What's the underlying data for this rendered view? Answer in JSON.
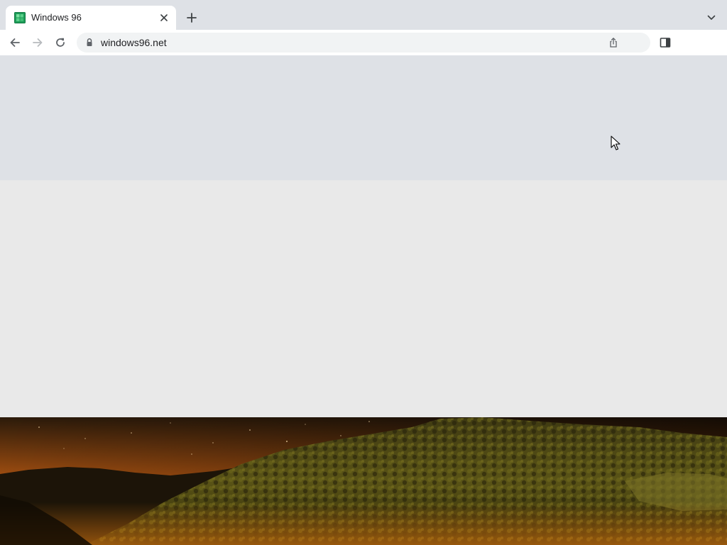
{
  "browser": {
    "tab": {
      "title": "Windows 96",
      "favicon": "windows-logo-icon",
      "close_icon": "close-icon"
    },
    "new_tab_icon": "plus-icon",
    "tab_list_icon": "chevron-down-icon",
    "toolbar": {
      "back_icon": "arrow-left-icon",
      "forward_icon": "arrow-right-icon",
      "reload_icon": "reload-icon",
      "address": {
        "lock_icon": "lock-icon",
        "url": "windows96.net",
        "share_icon": "share-icon"
      },
      "side_panel_icon": "side-panel-icon"
    }
  },
  "page": {
    "banner_color": "#dee1e6",
    "body_color": "#e9e9e9",
    "background_image": "night-landscape-with-wooded-hills-and-stars"
  },
  "colors": {
    "tab_active": "#ffffff",
    "tabstrip": "#dee1e6",
    "omnibox": "#f1f3f4",
    "icon": "#5f6368",
    "icon_disabled": "#b8bbbf",
    "favicon": "#1a9e5a"
  }
}
